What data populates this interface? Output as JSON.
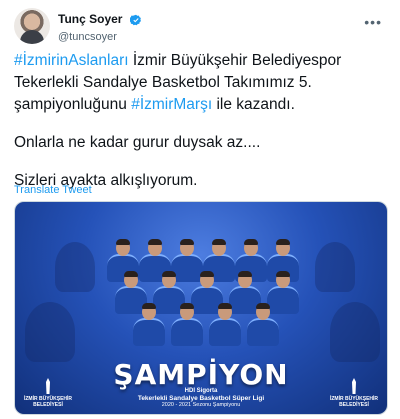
{
  "author": {
    "display_name": "Tunç Soyer",
    "handle": "@tuncsoyer",
    "verified_icon": "verified-badge-icon",
    "more_icon": "more-options-icon"
  },
  "tweet": {
    "hashtag1": "#İzmirinAslanları",
    "line1_rest": " İzmir Büyükşehir Belediyespor Tekerlekli Sandalye Basketbol Takımımız 5. şampiyonluğunu ",
    "hashtag2": "#İzmirMarşı",
    "line1_end": " ile kazandı.",
    "line2": "Onlarla ne kadar gurur duysak az....",
    "line3": "Sizleri ayakta alkışlıyorum.",
    "translate_label": "Translate Tweet"
  },
  "media": {
    "title": "ŞAMPİYON",
    "sponsor": "HDI Sigorta",
    "league": "Tekerlekli Sandalye Basketbol Süper Ligi",
    "season": "2020 - 2021 Sezonu Şampiyonu",
    "logo_left": "İZMİR BÜYÜKŞEHİR BELEDİYESİ",
    "logo_right": "İZMİR BÜYÜKŞEHİR BELEDİYESİ"
  },
  "colors": {
    "link": "#1d9bf0",
    "text": "#0f1419",
    "secondary": "#536471",
    "media_blue": "#2552b8"
  }
}
